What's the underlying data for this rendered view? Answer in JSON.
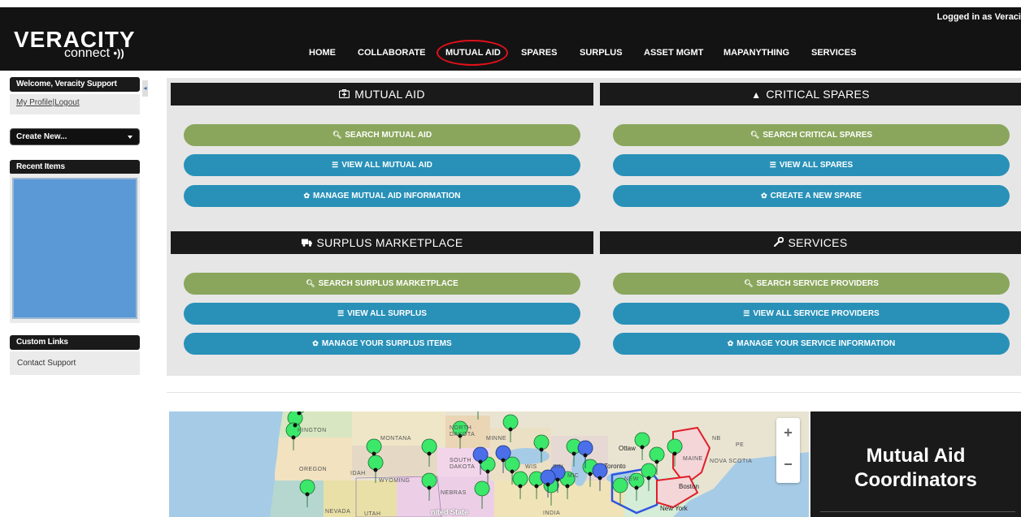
{
  "header": {
    "logo_name": "VERACITY",
    "logo_sub": "connect",
    "logged_in_text": "Logged in as Veraci",
    "nav": [
      {
        "label": "HOME"
      },
      {
        "label": "COLLABORATE"
      },
      {
        "label": "MUTUAL AID",
        "highlighted": true
      },
      {
        "label": "SPARES"
      },
      {
        "label": "SURPLUS"
      },
      {
        "label": "ASSET MGMT"
      },
      {
        "label": "MAPANYTHING"
      },
      {
        "label": "SERVICES"
      }
    ]
  },
  "sidebar": {
    "welcome": "Welcome, Veracity Support",
    "my_profile": "My Profile",
    "logout": "Logout",
    "create_new": "Create New...",
    "recent_items": "Recent Items",
    "custom_links": "Custom Links",
    "contact_support": "Contact Support"
  },
  "sections": {
    "mutual_aid": {
      "title": "MUTUAL AID",
      "icon": "medkit-icon",
      "buttons": [
        "SEARCH MUTUAL AID",
        "VIEW ALL MUTUAL AID",
        "MANAGE MUTUAL AID INFORMATION"
      ]
    },
    "critical_spares": {
      "title": "CRITICAL SPARES",
      "icon": "warning-icon",
      "buttons": [
        "SEARCH CRITICAL SPARES",
        "VIEW ALL SPARES",
        "CREATE A NEW SPARE"
      ]
    },
    "surplus": {
      "title": "SURPLUS MARKETPLACE",
      "icon": "truck-icon",
      "buttons": [
        "SEARCH SURPLUS MARKETPLACE",
        "VIEW ALL SURPLUS",
        "MANAGE YOUR SURPLUS ITEMS"
      ]
    },
    "services": {
      "title": "SERVICES",
      "icon": "wrench-icon",
      "buttons": [
        "SEARCH SERVICE PROVIDERS",
        "VIEW ALL SERVICE PROVIDERS",
        "MANAGE YOUR SERVICE INFORMATION"
      ]
    }
  },
  "map": {
    "region_labels": [
      "HINGTON",
      "MONTANA",
      "NORTH DAKOTA",
      "MINNE",
      "SOUTH DAKOTA",
      "WIS",
      "SIN",
      "MIC",
      "OREGON",
      "IDAH",
      "WYOMING",
      "NEBRAS",
      "NEVADA",
      "UTAH",
      "NB",
      "PE",
      "MAINE",
      "NOVA SCOTIA",
      "NEW",
      "INDIA"
    ],
    "city_labels": [
      "Ottaw",
      "Toronto",
      "Boston",
      "New York",
      "nited State"
    ],
    "zoom_in": "+",
    "zoom_out": "−"
  },
  "coordinators": {
    "title_line1": "Mutual Aid",
    "title_line2": "Coordinators"
  },
  "colors": {
    "green_button": "#8aa65c",
    "blue_button": "#2991b8",
    "header_bg": "#131313",
    "highlight_ring": "#e0101a",
    "green_marker": "#3ce86a",
    "blue_marker": "#4a6fe8"
  }
}
